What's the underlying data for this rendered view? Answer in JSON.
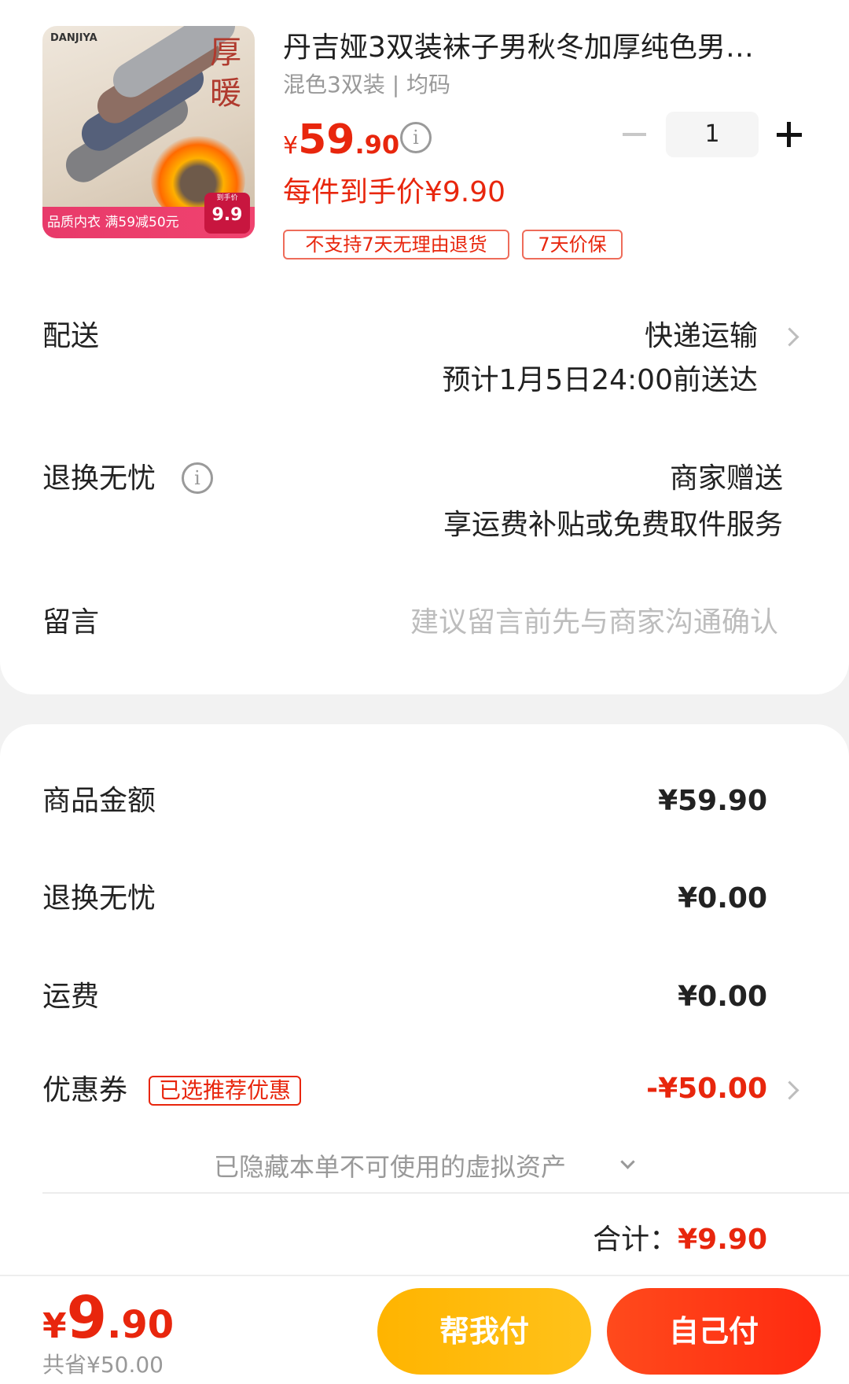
{
  "product": {
    "title": "丹吉娅3双装袜子男秋冬加厚纯色男…",
    "spec": "混色3双装 | 均码",
    "price_symbol": "¥",
    "price_int": "59",
    "price_dec": ".90",
    "quantity": "1",
    "unit_price": "每件到手价¥9.90",
    "tags": [
      "不支持7天无理由退货",
      "7天价保"
    ],
    "image": {
      "brand": "DANJIYA",
      "seal_text": "厚暖",
      "banner": "品质内衣 满59减50元",
      "price_tag_small": "到手价",
      "price_tag": "9.9"
    }
  },
  "delivery": {
    "label": "配送",
    "method": "快递运输",
    "eta": "预计1月5日24:00前送达"
  },
  "return_service": {
    "label": "退换无忧",
    "value": "商家赠送",
    "desc": "享运费补贴或免费取件服务"
  },
  "message": {
    "label": "留言",
    "placeholder": "建议留言前先与商家沟通确认"
  },
  "summary": {
    "goods_label": "商品金额",
    "goods_value": "¥59.90",
    "return_label": "退换无忧",
    "return_value": "¥0.00",
    "shipping_label": "运费",
    "shipping_value": "¥0.00",
    "coupon_label": "优惠券",
    "coupon_tag": "已选推荐优惠",
    "coupon_value": "-¥50.00",
    "hidden_assets": "已隐藏本单不可使用的虚拟资产",
    "total_label": "合计：",
    "total_value": "¥9.90"
  },
  "bottom": {
    "price_symbol": "¥",
    "price_int": "9",
    "price_dec": ".90",
    "saved": "共省¥50.00",
    "help_pay": "帮我付",
    "self_pay": "自己付"
  },
  "colors": {
    "accent_red": "#e8260d",
    "accent_yellow": "#ffb400",
    "background": "#f2f2f2"
  }
}
